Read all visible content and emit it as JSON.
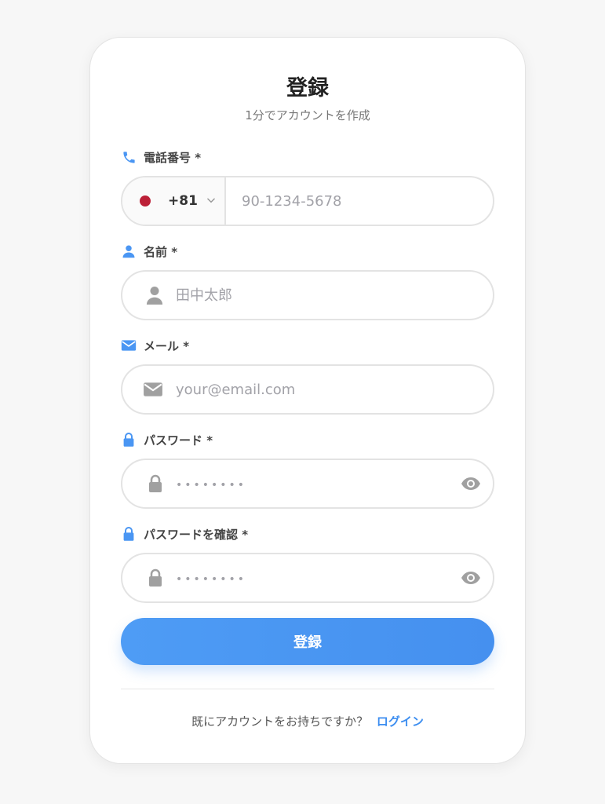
{
  "header": {
    "title": "登録",
    "subtitle": "1分でアカウントを作成"
  },
  "phone": {
    "label": "電話番号 *",
    "country_code": "+81",
    "placeholder": "90-1234-5678",
    "flag_color": "#bc2037"
  },
  "name": {
    "label": "名前 *",
    "placeholder": "田中太郎"
  },
  "email": {
    "label": "メール *",
    "placeholder": "your@email.com"
  },
  "password": {
    "label": "パスワード *",
    "placeholder": "••••••••"
  },
  "confirm_password": {
    "label": "パスワードを確認 *",
    "placeholder": "••••••••"
  },
  "submit": {
    "label": "登録"
  },
  "footer": {
    "prompt": "既にアカウントをお持ちですか？",
    "login_link": "ログイン"
  },
  "colors": {
    "accent": "#4a96f3",
    "icon_gray": "#a0a0a0",
    "border": "#e3e3e3"
  }
}
